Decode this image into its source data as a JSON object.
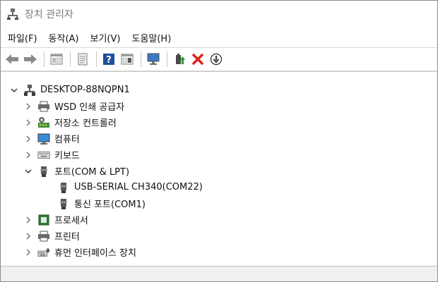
{
  "window": {
    "title": "장치 관리자",
    "title_icon": "device-manager-icon"
  },
  "menu": {
    "file": "파일(F)",
    "action": "동작(A)",
    "view": "보기(V)",
    "help": "도움말(H)"
  },
  "toolbar": {
    "buttons": [
      {
        "name": "back-arrow-icon"
      },
      {
        "name": "forward-arrow-icon"
      },
      {
        "name": "show-hide-console-tree-icon"
      },
      {
        "name": "properties-icon"
      },
      {
        "name": "help-icon"
      },
      {
        "name": "show-action-pane-icon"
      },
      {
        "name": "scan-hardware-changes-icon"
      },
      {
        "name": "update-driver-icon"
      },
      {
        "name": "uninstall-device-icon"
      },
      {
        "name": "disable-device-icon"
      }
    ],
    "accent_red": "#d9261c",
    "accent_blue": "#1e5fb4"
  },
  "tree": {
    "root": {
      "label": "DESKTOP-88NQPN1",
      "icon": "computer-tower-icon",
      "expanded": true
    },
    "categories": [
      {
        "label": "WSD 인쇄 공급자",
        "icon": "printer-icon",
        "expanded": false
      },
      {
        "label": "저장소 컨트롤러",
        "icon": "storage-controller-icon",
        "expanded": false
      },
      {
        "label": "컴퓨터",
        "icon": "monitor-icon",
        "expanded": false
      },
      {
        "label": "키보드",
        "icon": "keyboard-icon",
        "expanded": false
      },
      {
        "label": "포트(COM & LPT)",
        "icon": "port-icon",
        "expanded": true,
        "children": [
          {
            "label": "USB-SERIAL CH340(COM22)",
            "icon": "port-icon"
          },
          {
            "label": "통신 포트(COM1)",
            "icon": "port-icon"
          }
        ]
      },
      {
        "label": "프로세서",
        "icon": "processor-icon",
        "expanded": false
      },
      {
        "label": "프린터",
        "icon": "printer-icon",
        "expanded": false
      },
      {
        "label": "휴먼 인터페이스 장치",
        "icon": "hid-icon",
        "expanded": false
      }
    ]
  }
}
